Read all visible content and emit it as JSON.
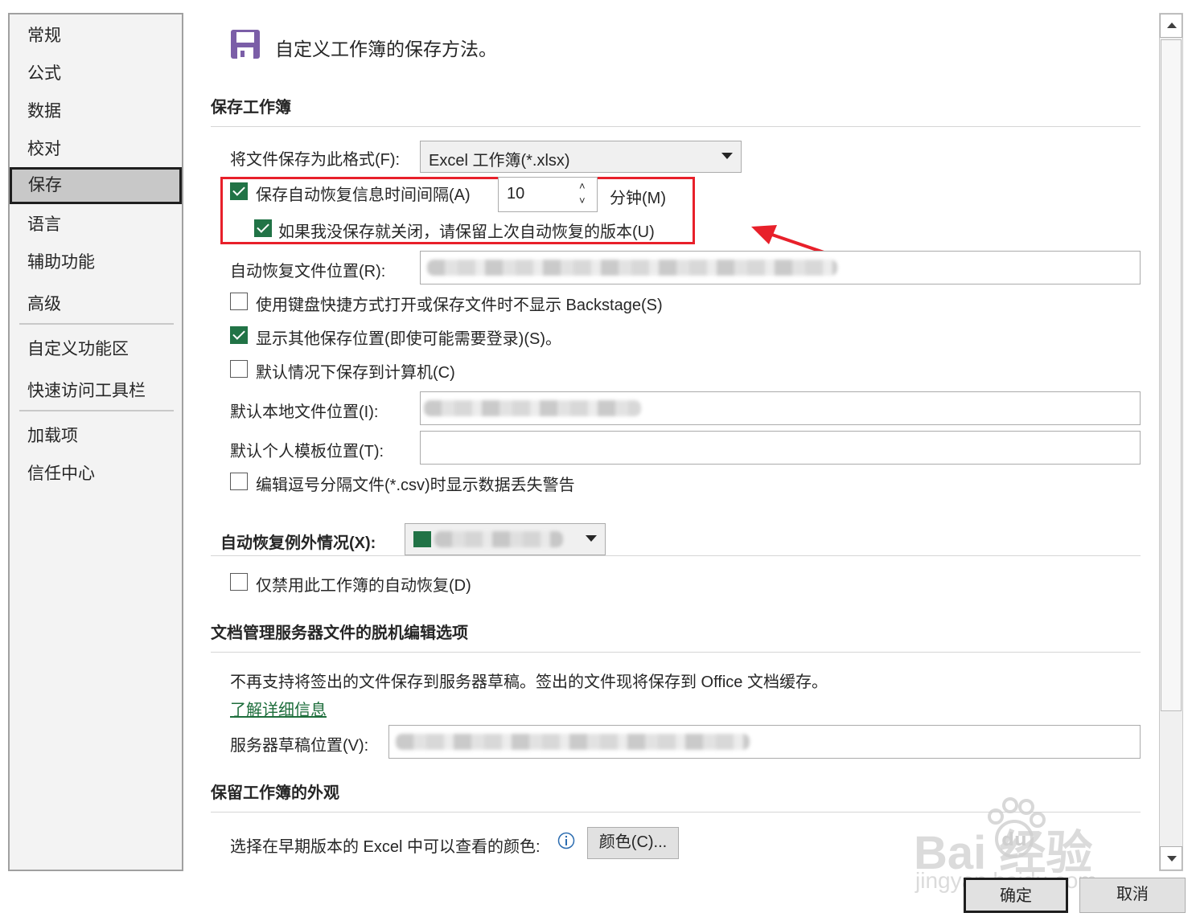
{
  "sidebar": {
    "items": [
      {
        "label": "常规"
      },
      {
        "label": "公式"
      },
      {
        "label": "数据"
      },
      {
        "label": "校对"
      },
      {
        "label": "保存",
        "selected": true
      },
      {
        "label": "语言"
      },
      {
        "label": "辅助功能"
      },
      {
        "label": "高级"
      },
      {
        "label": "自定义功能区"
      },
      {
        "label": "快速访问工具栏"
      },
      {
        "label": "加载项"
      },
      {
        "label": "信任中心"
      }
    ]
  },
  "header": {
    "icon": "save-icon",
    "icon_color": "#7b5ea7",
    "title": "自定义工作簿的保存方法。"
  },
  "save_workbooks": {
    "section_title": "保存工作簿",
    "format_label": "将文件保存为此格式(F):",
    "format_value": "Excel 工作簿(*.xlsx)",
    "autorecover": {
      "label": "保存自动恢复信息时间间隔(A)",
      "checked": true,
      "minutes": "10",
      "unit": "分钟(M)"
    },
    "keep_last": {
      "label": "如果我没保存就关闭，请保留上次自动恢复的版本(U)",
      "checked": true
    },
    "autorecover_location_label": "自动恢复文件位置(R):",
    "no_backstage": {
      "label": "使用键盘快捷方式打开或保存文件时不显示 Backstage(S)",
      "checked": false
    },
    "show_other_locations": {
      "label": "显示其他保存位置(即使可能需要登录)(S)。",
      "checked": true
    },
    "save_to_computer": {
      "label": "默认情况下保存到计算机(C)",
      "checked": false
    },
    "default_local_label": "默认本地文件位置(I):",
    "default_template_label": "默认个人模板位置(T):",
    "csv_warning": {
      "label": "编辑逗号分隔文件(*.csv)时显示数据丢失警告",
      "checked": false
    }
  },
  "autorecover_exceptions": {
    "section_title": "自动恢复例外情况(X):",
    "disable": {
      "label": "仅禁用此工作簿的自动恢复(D)",
      "checked": false
    }
  },
  "offline_editing": {
    "section_title": "文档管理服务器文件的脱机编辑选项",
    "info_text": "不再支持将签出的文件保存到服务器草稿。签出的文件现将保存到 Office 文档缓存。",
    "learn_more": "了解详细信息",
    "server_drafts_label": "服务器草稿位置(V):"
  },
  "appearance": {
    "section_title": "保留工作簿的外观",
    "colors_label": "选择在早期版本的 Excel 中可以查看的颜色:",
    "colors_button": "颜色(C)..."
  },
  "footer": {
    "ok": "确定",
    "cancel": "取消"
  },
  "watermark": {
    "brand": "Bai 经验",
    "paw_text": "du",
    "url": "jingyan.baidu.com"
  },
  "colors": {
    "accent_green": "#217346",
    "annotation_red": "#e8202a",
    "link_green": "#1e6e3c"
  }
}
